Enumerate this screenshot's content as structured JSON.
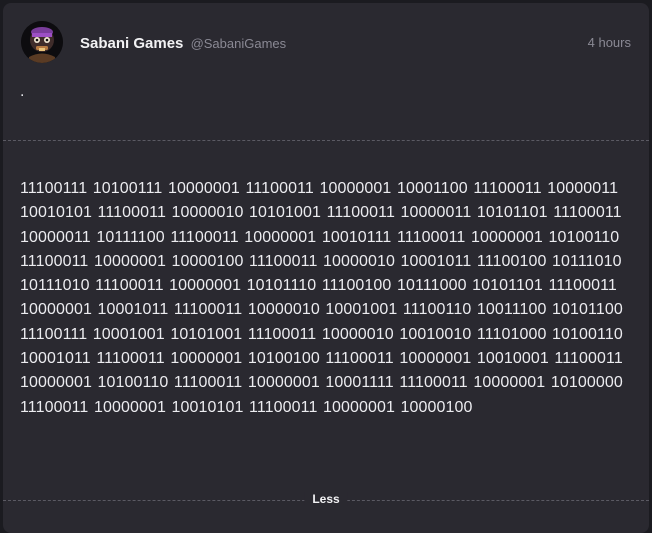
{
  "post": {
    "author_name": "Sabani Games",
    "author_handle": "@SabaniGames",
    "timestamp": "4 hours",
    "short_text": ".",
    "body_text": "11100111 10100111 10000001 11100011 10000001 10001100 11100011 10000011 10010101 11100011 10000010 10101001 11100011 10000011 10101101 11100011 10000011 10111100 11100011 10000001 10010111 11100011 10000001 10100110 11100011 10000001 10000100 11100011 10000010 10001011 11100100 10111010 10111010 11100011 10000001 10101110 11100100 10111000 10101101 11100011 10000001 10001011 11100011 10000010 10001001 11100110 10011100 10101100 11100111 10001001 10101001 11100011 10000010 10010010 11101000 10100110 10001011 11100011 10000001 10100100 11100011 10000001 10010001 11100011 10000001 10100110 11100011 10000001 10001111 11100011 10000001 10100000 11100011 10000001 10010101 11100011 10000001 10000100",
    "less_label": "Less"
  },
  "icons": {
    "avatar": "avatar-icon"
  },
  "colors": {
    "background": "#1b1b20",
    "card": "#2a2930",
    "text": "#ececf0",
    "muted": "#8a8994"
  }
}
